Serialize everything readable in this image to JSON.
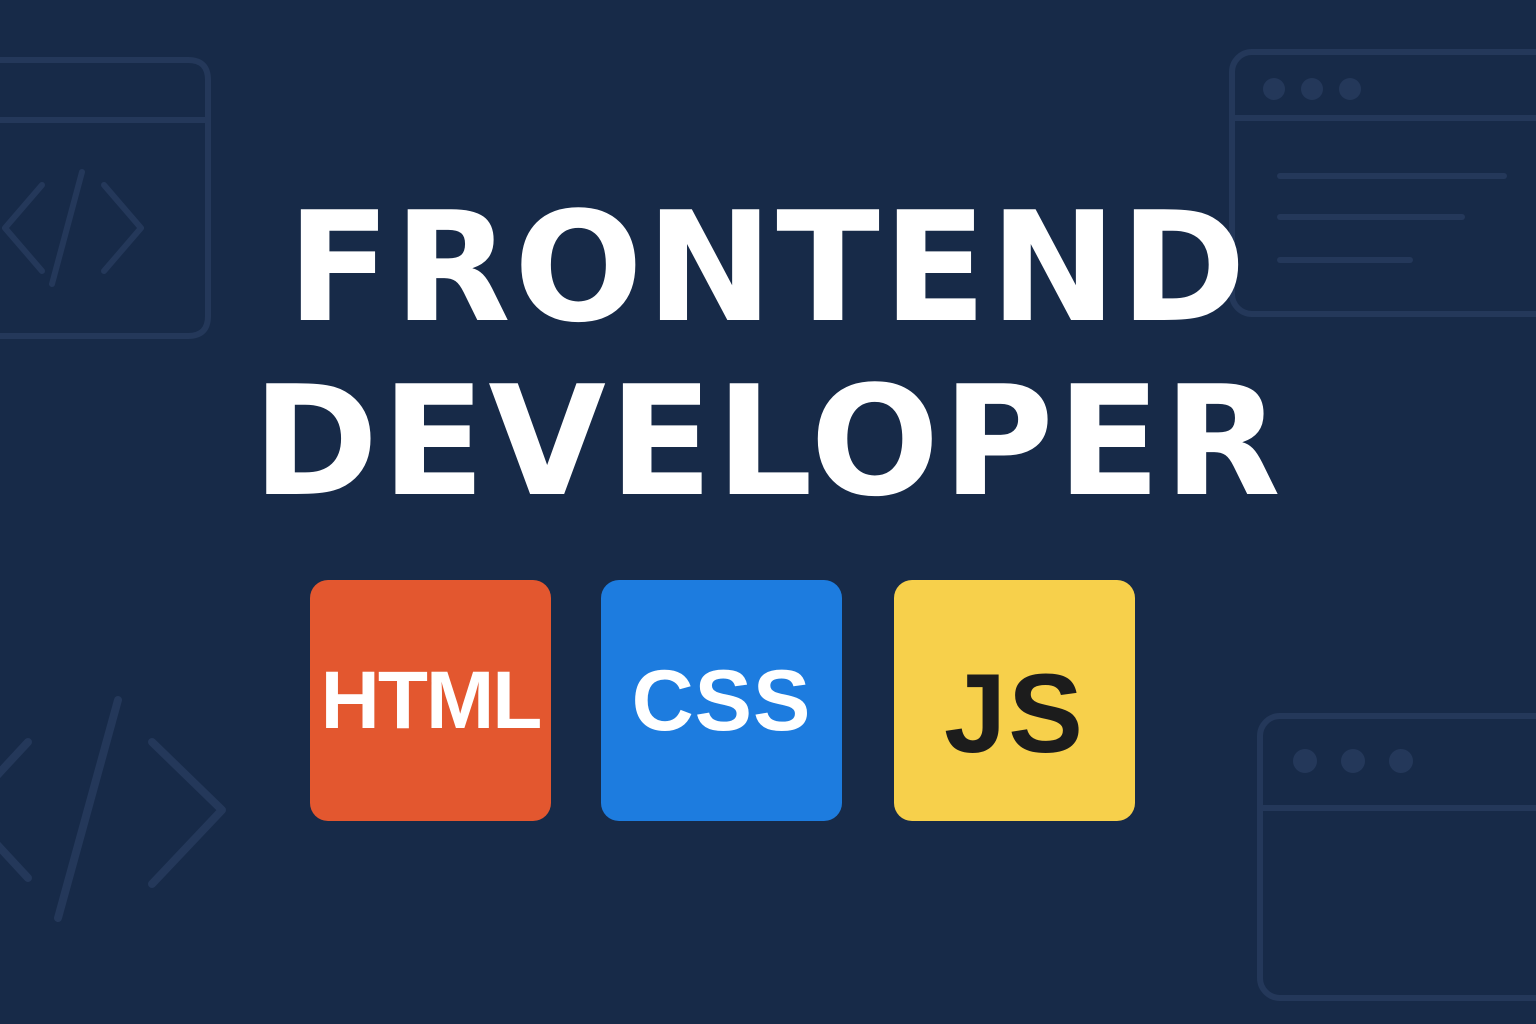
{
  "background_color": "#172A48",
  "decoration_color": "#24385A",
  "decorations": {
    "left_top": "code-window-icon",
    "left_bottom": "code-tag-icon",
    "right_top": "browser-window-icon",
    "right_bottom": "browser-window-icon"
  },
  "title": {
    "line1": "FRONTEND",
    "line2": "DEVELOPER",
    "color": "#FFFFFF"
  },
  "badges": [
    {
      "label": "HTML",
      "background": "#E3572F",
      "text_color": "#FFFFFF"
    },
    {
      "label": "CSS",
      "background": "#1D7CDF",
      "text_color": "#FFFFFF"
    },
    {
      "label": "JS",
      "background": "#F7D04B",
      "text_color": "#1C1C1C"
    }
  ]
}
